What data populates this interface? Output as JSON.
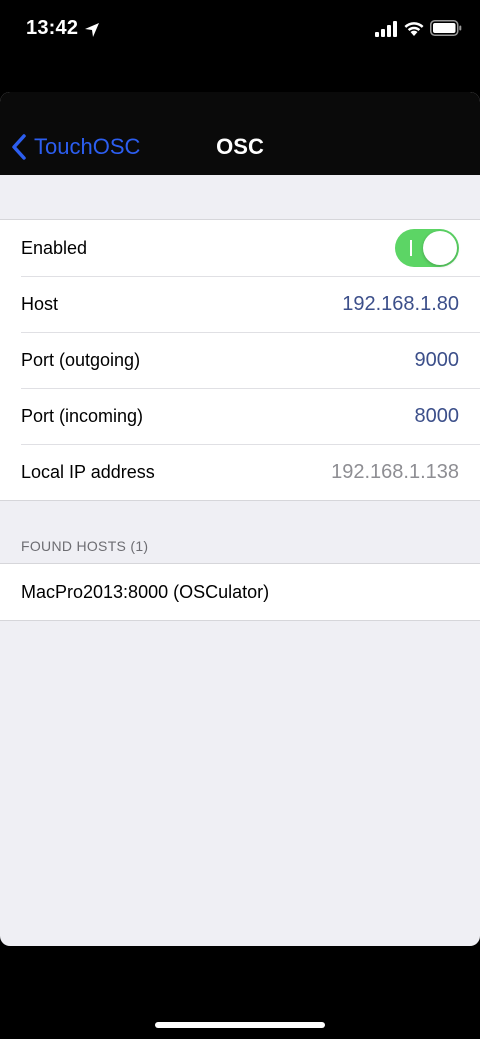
{
  "status_bar": {
    "time": "13:42"
  },
  "nav": {
    "back_label": "TouchOSC",
    "title": "OSC"
  },
  "settings": {
    "enabled_label": "Enabled",
    "enabled_value": true,
    "host_label": "Host",
    "host_value": "192.168.1.80",
    "port_out_label": "Port (outgoing)",
    "port_out_value": "9000",
    "port_in_label": "Port (incoming)",
    "port_in_value": "8000",
    "local_ip_label": "Local IP address",
    "local_ip_value": "192.168.1.138"
  },
  "found_hosts": {
    "header": "FOUND HOSTS (1)",
    "items": [
      {
        "label": "MacPro2013:8000 (OSCulator)"
      }
    ]
  },
  "colors": {
    "accent": "#2c5ef0",
    "value_text": "#3c4f8a",
    "toggle_on": "#5cd565",
    "group_bg": "#efeff4"
  },
  "icons": {
    "location": "location-arrow-icon",
    "signal": "cellular-signal-icon",
    "wifi": "wifi-icon",
    "battery": "battery-icon",
    "back": "chevron-left-icon"
  }
}
